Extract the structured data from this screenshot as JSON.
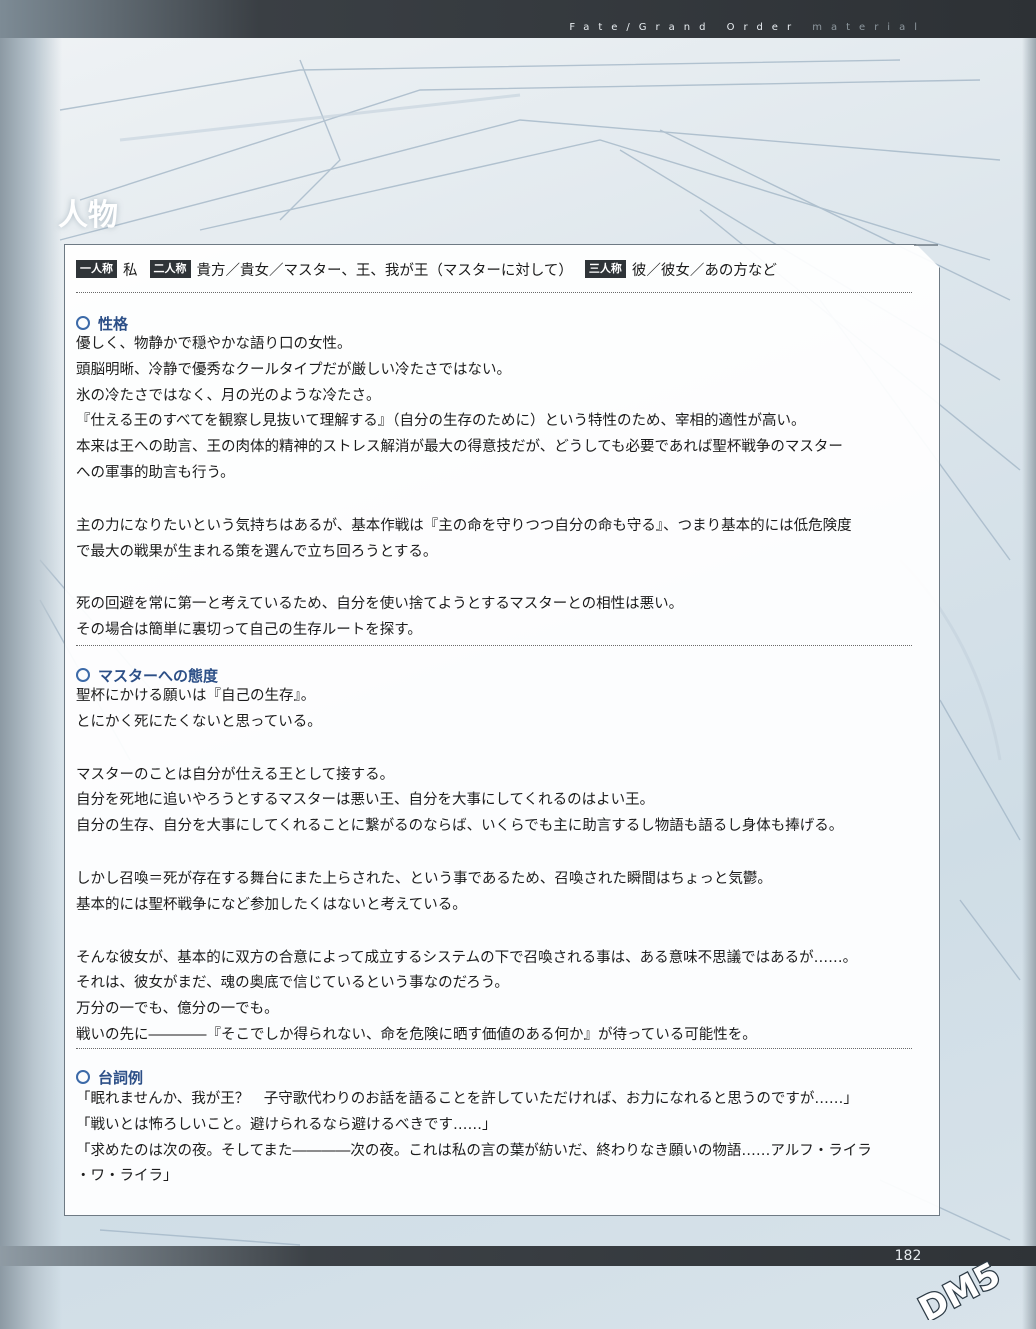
{
  "header": {
    "title": "Fate/Grand Order",
    "subtitle": "material"
  },
  "section_heading": "人物",
  "pronouns": {
    "first_person_label": "一人称",
    "first_person": "私",
    "second_person_label": "二人称",
    "second_person": "貴方／貴女／マスター、王、我が王（マスターに対して）",
    "third_person_label": "三人称",
    "third_person": "彼／彼女／あの方など"
  },
  "personality": {
    "heading": "性格",
    "paragraphs": [
      [
        "優しく、物静かで穏やかな語り口の女性。",
        "頭脳明晰、冷静で優秀なクールタイプだが厳しい冷たさではない。",
        "氷の冷たさではなく、月の光のような冷たさ。",
        "『仕える王のすべてを観察し見抜いて理解する』（自分の生存のために）という特性のため、宰相的適性が高い。",
        "本来は王への助言、王の肉体的精神的ストレス解消が最大の得意技だが、どうしても必要であれば聖杯戦争のマスター",
        "への軍事的助言も行う。"
      ],
      [
        "主の力になりたいという気持ちはあるが、基本作戦は『主の命を守りつつ自分の命も守る』、つまり基本的には低危険度",
        "で最大の戦果が生まれる策を選んで立ち回ろうとする。"
      ],
      [
        "死の回避を常に第一と考えているため、自分を使い捨てようとするマスターとの相性は悪い。",
        "その場合は簡単に裏切って自己の生存ルートを探す。"
      ]
    ]
  },
  "attitude": {
    "heading": "マスターへの態度",
    "paragraphs": [
      [
        "聖杯にかける願いは『自己の生存』。",
        "とにかく死にたくないと思っている。"
      ],
      [
        "マスターのことは自分が仕える王として接する。",
        "自分を死地に追いやろうとするマスターは悪い王、自分を大事にしてくれるのはよい王。",
        "自分の生存、自分を大事にしてくれることに繋がるのならば、いくらでも主に助言するし物語も語るし身体も捧げる。"
      ],
      [
        "しかし召喚＝死が存在する舞台にまた上らされた、という事であるため、召喚された瞬間はちょっと気鬱。",
        "基本的には聖杯戦争になど参加したくはないと考えている。"
      ],
      [
        "そんな彼女が、基本的に双方の合意によって成立するシステムの下で召喚される事は、ある意味不思議ではあるが……。",
        "それは、彼女がまだ、魂の奥底で信じているという事なのだろう。",
        "万分の一でも、億分の一でも。",
        "戦いの先に――――『そこでしか得られない、命を危険に晒す価値のある何か』が待っている可能性を。"
      ]
    ]
  },
  "lines": {
    "heading": "台詞例",
    "items": [
      "「眠れませんか、我が王？　子守歌代わりのお話を語ることを許していただければ、お力になれると思うのですが……」",
      "「戦いとは怖ろしいこと。避けられるなら避けるべきです……」",
      "「求めたのは次の夜。そしてまた――――次の夜。これは私の言の葉が紡いだ、終わりなき願いの物語……アルフ・ライラ",
      "・ワ・ライラ」"
    ]
  },
  "footer": {
    "page_number": "182",
    "watermark": "DM5"
  }
}
